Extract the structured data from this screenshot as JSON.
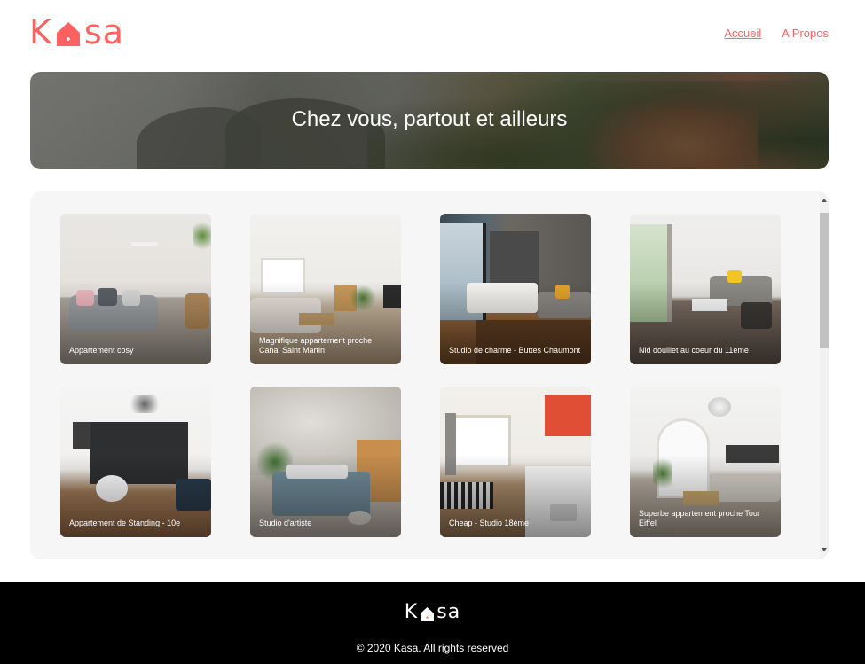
{
  "header": {
    "logo_left": "K",
    "logo_right": "sa",
    "logo_icon": "house-icon",
    "nav": {
      "home_label": "Accueil",
      "about_label": "A Propos"
    }
  },
  "banner": {
    "title": "Chez vous, partout et ailleurs"
  },
  "gallery": {
    "cards": [
      {
        "title": "Appartement cosy"
      },
      {
        "title": "Magnifique appartement proche Canal Saint Martin"
      },
      {
        "title": "Studio de charme - Buttes Chaumont"
      },
      {
        "title": "Nid douillet au coeur du 11ème"
      },
      {
        "title": "Appartement de Standing - 10e"
      },
      {
        "title": "Studio d'artiste"
      },
      {
        "title": "Cheap - Studio 18ème"
      },
      {
        "title": "Superbe appartement proche Tour Eiffel"
      }
    ]
  },
  "footer": {
    "logo_left": "K",
    "logo_right": "sa",
    "copyright": "© 2020 Kasa. All rights reserved"
  },
  "colors": {
    "brand": "#ff6060",
    "gallery_bg": "#f6f6f6",
    "footer_bg": "#000000"
  }
}
